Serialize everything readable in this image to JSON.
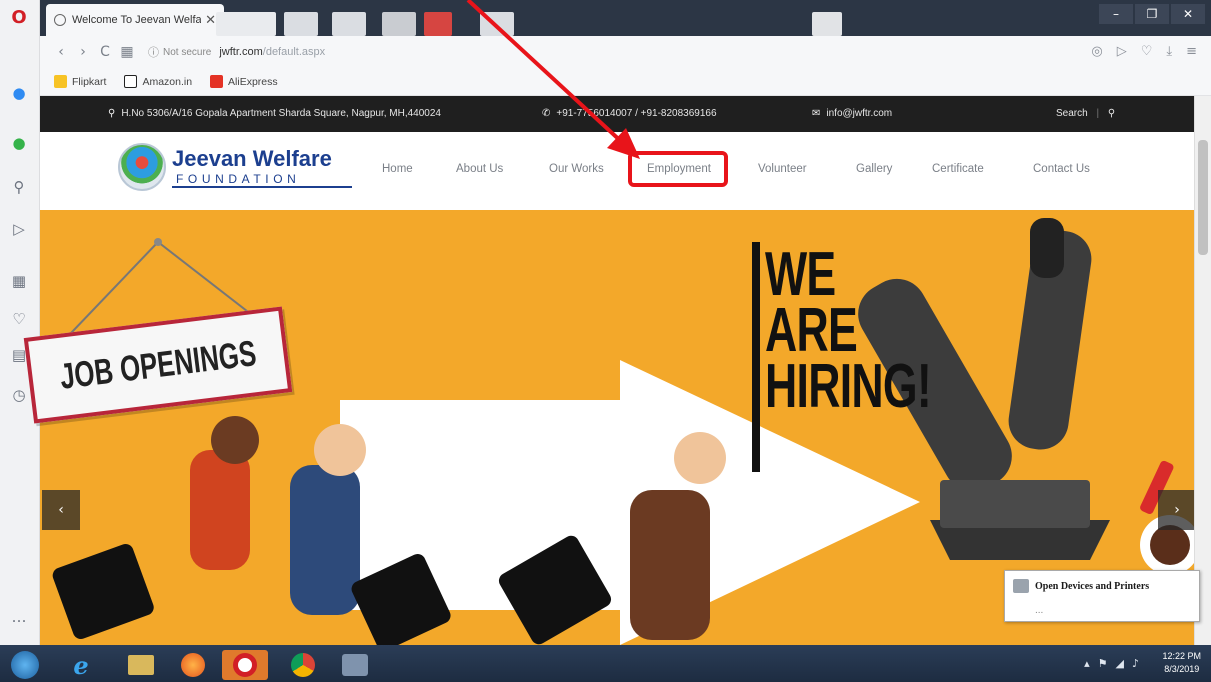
{
  "browser": {
    "tab_title": "Welcome To Jeevan Welfa",
    "tab_close": "✕",
    "window_controls": [
      "–",
      "❐",
      "✕"
    ],
    "address": {
      "security": "Not secure",
      "domain": "jwftr.com",
      "path": "/default.aspx"
    },
    "nav_icons": [
      "back-icon",
      "forward-icon",
      "reload-icon",
      "speed-dial-icon"
    ],
    "nav_glyphs": [
      "‹",
      "›",
      "C",
      "▦"
    ],
    "addr_right_glyphs": [
      "◎",
      "▷",
      "♡",
      "⤓",
      "≡"
    ],
    "bookmarks": [
      {
        "label": "Flipkart",
        "color": "#f7c325"
      },
      {
        "label": "Amazon.in",
        "color": "#222222"
      },
      {
        "label": "AliExpress",
        "color": "#e43225"
      }
    ]
  },
  "sidebar": {
    "icons": [
      {
        "name": "opera-logo-icon",
        "glyph": "O"
      },
      {
        "name": "messenger-icon",
        "glyph": "●"
      },
      {
        "name": "whatsapp-icon",
        "glyph": "●"
      },
      {
        "name": "search-icon",
        "glyph": "⚲"
      },
      {
        "name": "flow-icon",
        "glyph": "▷"
      },
      {
        "name": "speed-dial-icon",
        "glyph": "▦"
      },
      {
        "name": "heart-icon",
        "glyph": "♡"
      },
      {
        "name": "news-icon",
        "glyph": "▤"
      },
      {
        "name": "history-icon",
        "glyph": "◷"
      },
      {
        "name": "more-icon",
        "glyph": "…"
      }
    ]
  },
  "site": {
    "info": {
      "address": "H.No 5306/A/16 Gopala Apartment Sharda Square, Nagpur, MH,440024",
      "phone": "+91-7756014007 / +91-8208369166",
      "email": "info@jwftr.com",
      "search": "Search",
      "search_icon": "⚲"
    },
    "brand": {
      "name": "Jeevan Welfare",
      "sub": "FOUNDATION"
    },
    "menu": [
      "Home",
      "About Us",
      "Our Works",
      "Employment",
      "Volunteer",
      "Gallery",
      "Certificate",
      "Contact Us"
    ],
    "hero": {
      "sign_text": "JOB OPENINGS",
      "hiring_lines": [
        "WE",
        "ARE",
        "HIRING!"
      ],
      "prev": "‹",
      "next": "›"
    }
  },
  "tooltip": {
    "title": "Open Devices and Printers",
    "detail": "..."
  },
  "taskbar": {
    "clock_time": "12:22 PM",
    "clock_date": "8/3/2019",
    "tray_glyphs": [
      "▴",
      "⚑",
      "◢",
      "♪"
    ],
    "apps": [
      {
        "name": "start-button",
        "color": "#3a88c9"
      },
      {
        "name": "ie-icon",
        "color": "#1e76c9"
      },
      {
        "name": "file-explorer-icon",
        "color": "#d9b85c"
      },
      {
        "name": "firefox-icon",
        "color": "#e66b1f"
      },
      {
        "name": "opera-icon",
        "color": "#d21f26"
      },
      {
        "name": "chrome-icon",
        "color": "#4aa04c"
      },
      {
        "name": "control-panel-icon",
        "color": "#7f93ad"
      }
    ]
  },
  "colors": {
    "highlight": "#e8141a",
    "hero_bg": "#f3a82a",
    "brand": "#1c3f8f",
    "infobar": "#1f1f1f"
  }
}
